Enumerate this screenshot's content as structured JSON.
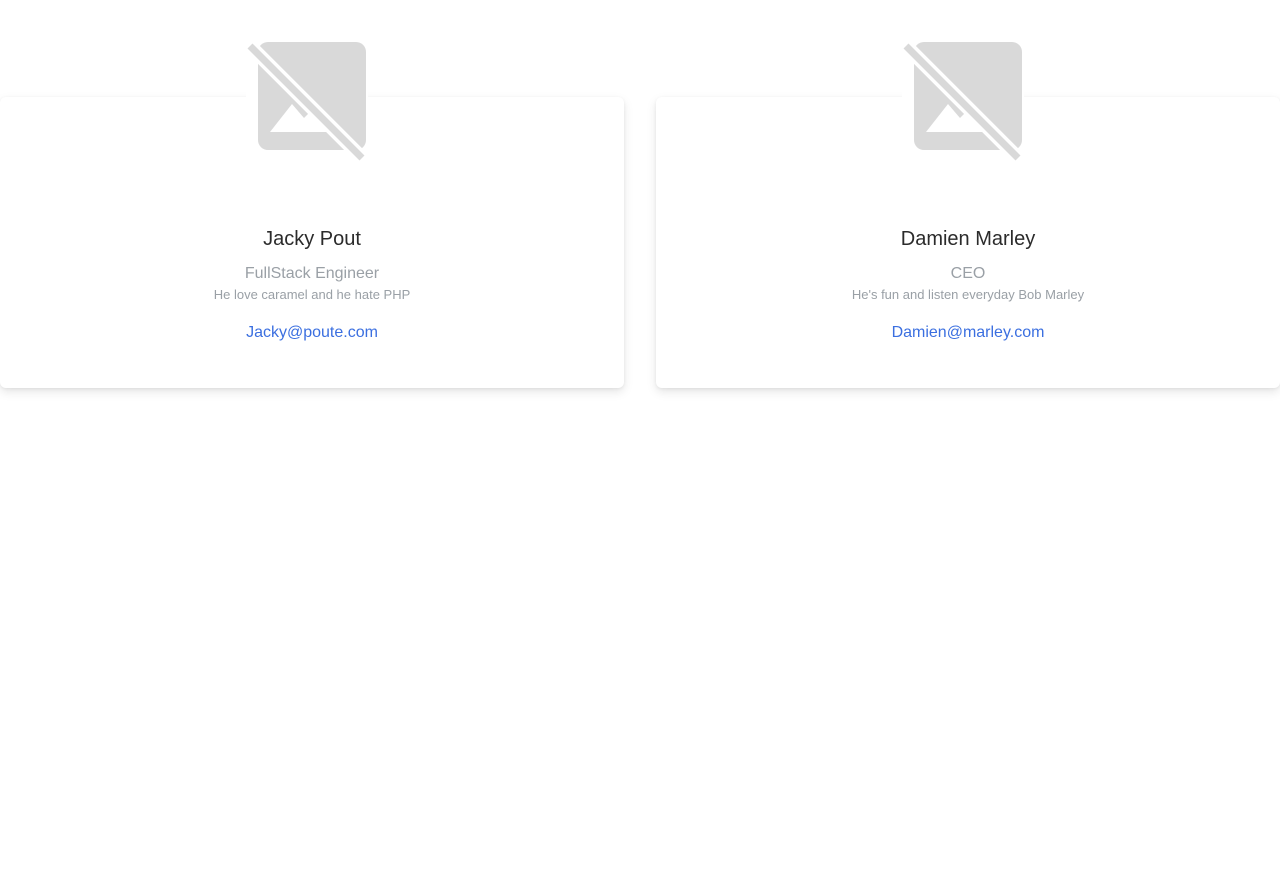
{
  "profiles": [
    {
      "name": "Jacky Pout",
      "role": "FullStack Engineer",
      "bio": "He love caramel and he hate PHP",
      "email": "Jacky@poute.com",
      "avatar_icon": "broken-image-icon"
    },
    {
      "name": "Damien Marley",
      "role": "CEO",
      "bio": "He's fun and listen everyday Bob Marley",
      "email": "Damien@marley.com",
      "avatar_icon": "broken-image-icon"
    }
  ],
  "colors": {
    "name": "#2b2b2b",
    "muted": "#9aa0a6",
    "link": "#3b6fe0",
    "placeholder": "#d9d9d9"
  }
}
